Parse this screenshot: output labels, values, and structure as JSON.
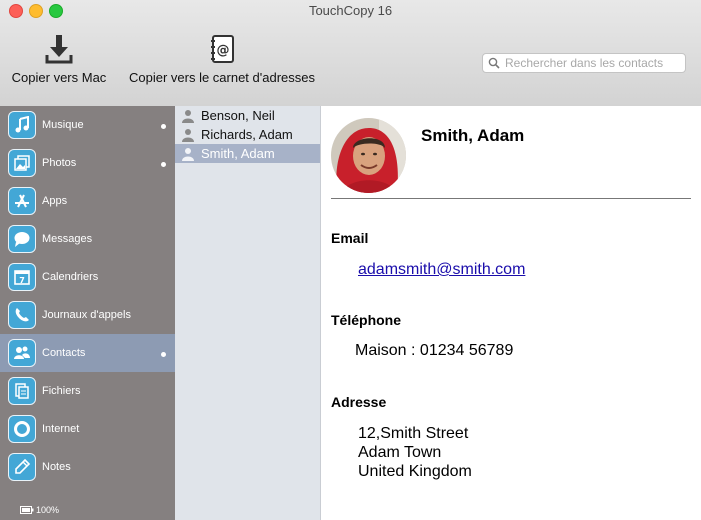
{
  "window": {
    "title": "TouchCopy 16"
  },
  "toolbar": {
    "copy_mac_label": "Copier vers Mac",
    "copy_book_label": "Copier vers le carnet d'adresses",
    "search_placeholder": "Rechercher dans les contacts"
  },
  "sidebar": {
    "items": [
      {
        "label": "Musique",
        "icon": "music-note-icon",
        "dot": true
      },
      {
        "label": "Photos",
        "icon": "photos-icon",
        "dot": true
      },
      {
        "label": "Apps",
        "icon": "app-store-icon",
        "dot": false
      },
      {
        "label": "Messages",
        "icon": "speech-bubble-icon",
        "dot": false
      },
      {
        "label": "Calendriers",
        "icon": "calendar-icon",
        "dot": false
      },
      {
        "label": "Journaux d'appels",
        "icon": "phone-icon",
        "dot": false
      },
      {
        "label": "Contacts",
        "icon": "contacts-icon",
        "dot": true,
        "selected": true
      },
      {
        "label": "Fichiers",
        "icon": "files-icon",
        "dot": false
      },
      {
        "label": "Internet",
        "icon": "internet-icon",
        "dot": false
      },
      {
        "label": "Notes",
        "icon": "pencil-icon",
        "dot": false
      }
    ],
    "battery": "100%"
  },
  "contacts": [
    {
      "name": "Benson, Neil"
    },
    {
      "name": "Richards, Adam"
    },
    {
      "name": "Smith, Adam",
      "selected": true
    }
  ],
  "detail": {
    "name": "Smith, Adam",
    "email_label": "Email",
    "email": "adamsmith@smith.com",
    "phone_label": "Téléphone",
    "phone": "Maison : 01234 56789",
    "address_label": "Adresse",
    "address_lines": [
      "12,Smith Street",
      "Adam Town",
      "United Kingdom"
    ]
  },
  "colors": {
    "sidebar_bg": "#858080",
    "sidebar_selected": "#8d9bb3",
    "icon_blue": "#43a7d6",
    "list_bg": "#e0e4ea",
    "list_selected": "#a7b2c8",
    "link": "#1a0dab"
  }
}
